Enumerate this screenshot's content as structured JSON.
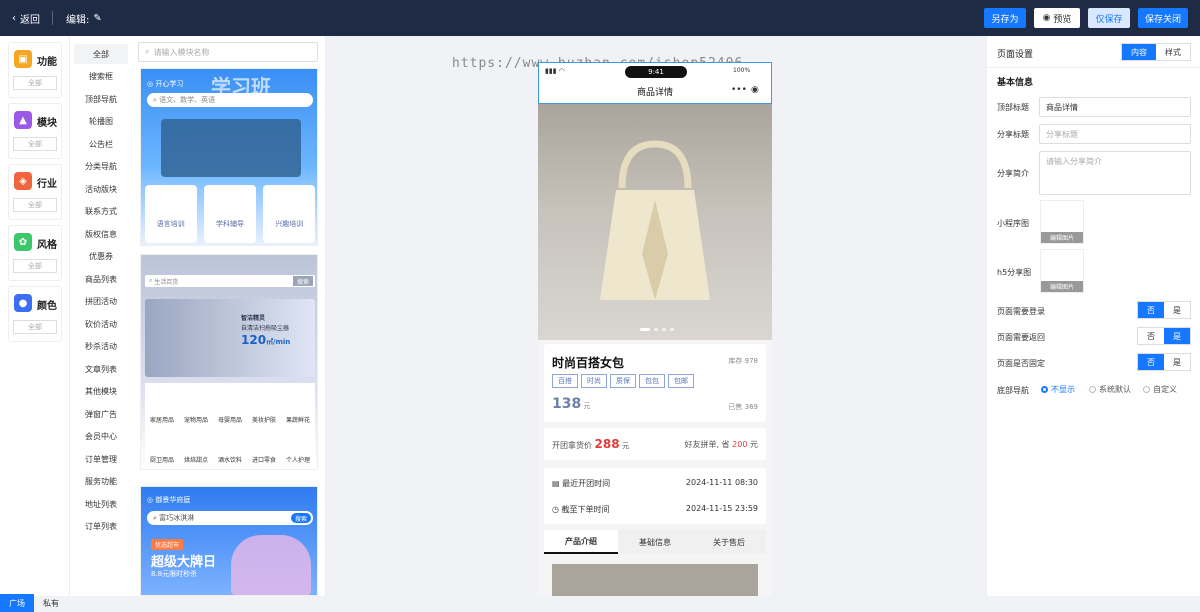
{
  "topbar": {
    "back_label": "返回",
    "edit_label": "编辑:",
    "save_as": "另存为",
    "preview": "预览",
    "save_only": "仅保存",
    "save_close": "保存关闭"
  },
  "categories": [
    {
      "label": "功能",
      "all": "全部",
      "color": "#f5a623"
    },
    {
      "label": "模块",
      "all": "全部",
      "color": "#9b59e6"
    },
    {
      "label": "行业",
      "all": "全部",
      "color": "#f0653b"
    },
    {
      "label": "风格",
      "all": "全部",
      "color": "#3cc76d"
    },
    {
      "label": "颜色",
      "all": "全部",
      "color": "#3b6ef0"
    }
  ],
  "scope": {
    "square": "广场",
    "private": "私有"
  },
  "subnav": [
    "全部",
    "搜索框",
    "顶部导航",
    "轮播图",
    "公告栏",
    "分类导航",
    "活动版块",
    "联系方式",
    "版权信息",
    "优惠券",
    "商品列表",
    "拼团活动",
    "砍价活动",
    "秒杀活动",
    "文章列表",
    "其他模块",
    "弹窗广告",
    "会员中心",
    "订单管理",
    "服务功能",
    "地址列表",
    "订单列表"
  ],
  "template_search_placeholder": "请输入模块名称",
  "tpl1": {
    "brand": "开心学习",
    "title": "学习班",
    "search": "语文、数学、英语",
    "items": [
      "语言培训",
      "学科辅导",
      "兴趣培训"
    ]
  },
  "tpl2": {
    "search": "生活百货",
    "search_btn": "搜索",
    "banner_t1": "智洁精灵",
    "banner_t2": "自清洁扫拖吸尘器",
    "banner_num": "120",
    "banner_unit": "㎡/min",
    "items": [
      "家居用品",
      "宠物用品",
      "母婴用品",
      "美妆护肤",
      "果蔬鲜花",
      "厨卫用品",
      "烘焙甜点",
      "酒水饮料",
      "进口零食",
      "个人护理"
    ]
  },
  "tpl3": {
    "brand": "御景华府庭",
    "search": "富巧冰淇淋",
    "search_btn": "搜索",
    "tag": "优选超市",
    "title": "超级大牌日",
    "sub": "8.8元限时秒杀"
  },
  "watermark": "https://www.huzhan.com/ishop52406",
  "phone": {
    "status_time": "9:41",
    "battery": "100%",
    "page_title": "商品详情",
    "product_name": "时尚百搭女包",
    "stock": "库存 978",
    "tags": [
      "百搭",
      "时尚",
      "质保",
      "包包",
      "包邮"
    ],
    "price": "138",
    "price_unit": "元",
    "sold": "已售 369",
    "group_label": "开团拿货价",
    "group_price": "288",
    "group_unit": "元",
    "friend_label": "好友拼单, 省",
    "friend_save": "200",
    "friend_unit": "元",
    "open_label": "最近开团时间",
    "open_time": "2024-11-11 08:30",
    "end_label": "截至下单时间",
    "end_time": "2024-11-15 23:59",
    "tabs": [
      "产品介绍",
      "基础信息",
      "关于售后"
    ]
  },
  "settings": {
    "title": "页面设置",
    "tab_content": "内容",
    "tab_style": "样式",
    "section": "基本信息",
    "top_title_label": "顶部标题",
    "top_title_value": "商品详情",
    "share_title_label": "分享标题",
    "share_title_placeholder": "分享标题",
    "share_desc_label": "分享简介",
    "share_desc_placeholder": "请输入分享简介",
    "mini_img_label": "小程序图",
    "h5_img_label": "h5分享图",
    "edit_img": "编辑图片",
    "login_label": "页面需要登录",
    "back_label": "页面需要返回",
    "fixed_label": "页面是否固定",
    "no": "否",
    "yes": "是",
    "login_value": "否",
    "back_value": "是",
    "fixed_value": "否",
    "nav_label": "底部导航",
    "nav_options": [
      "不显示",
      "系统默认",
      "自定义"
    ],
    "nav_value": "不显示"
  }
}
